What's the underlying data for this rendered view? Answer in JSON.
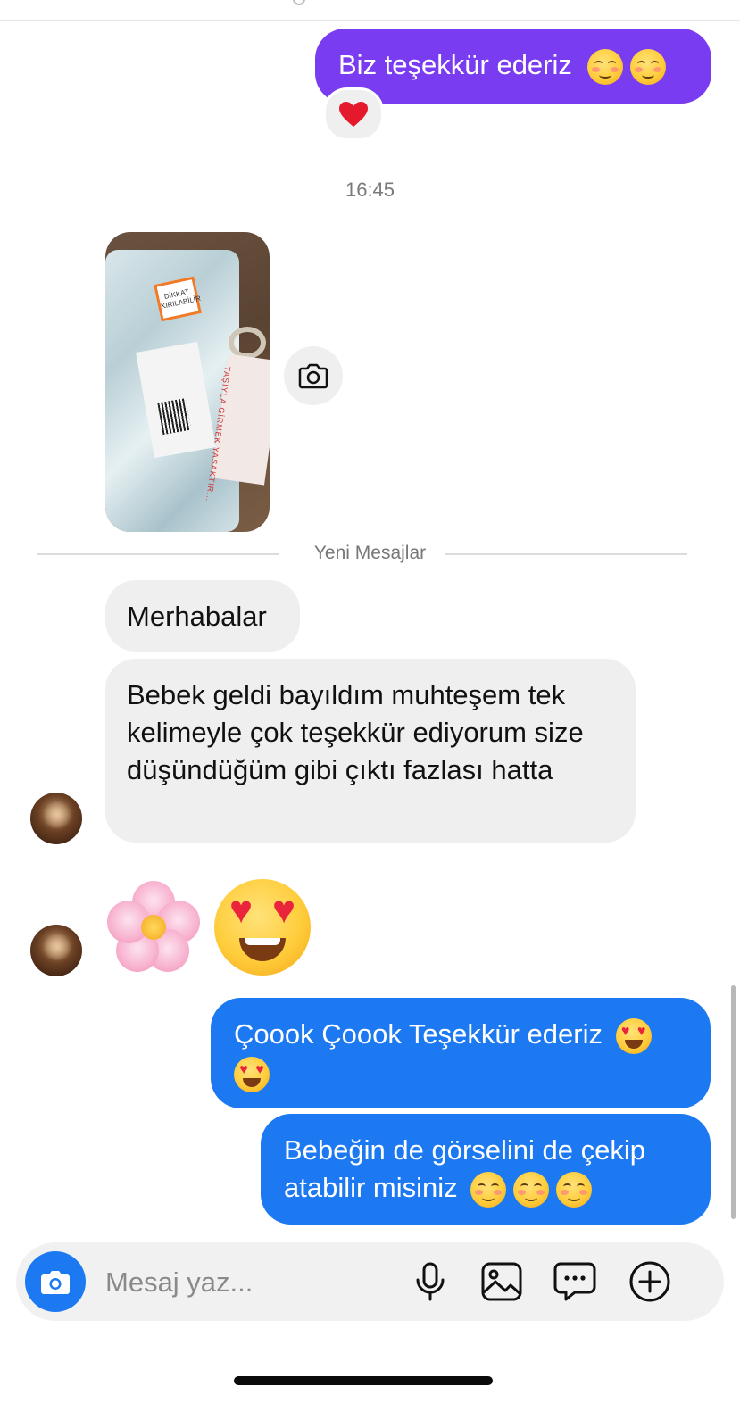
{
  "thread": {
    "timestamp": "16:45",
    "new_messages_label": "Yeni Mesajlar",
    "messages": [
      {
        "from": "me",
        "text": "Biz teşekkür ederiz",
        "emoji": [
          "smiling-blush",
          "smiling-blush"
        ],
        "reaction": "heart"
      },
      {
        "from": "them",
        "type": "photo",
        "photo_text": [
          "DİKKAT KIRILABİLİR",
          "TAŞIYLA GİRMEK YASAKTIR..."
        ]
      },
      {
        "from": "them",
        "text": "Merhabalar"
      },
      {
        "from": "them",
        "text": "Bebek geldi bayıldım muhteşem tek kelimeyle çok teşekkür ediyorum size düşündüğüm gibi çıktı fazlası hatta"
      },
      {
        "from": "them",
        "type": "emoji",
        "emoji": [
          "cherry-blossom",
          "heart-eyes"
        ]
      },
      {
        "from": "me",
        "text": "Çoook Çoook Teşekkür ederiz",
        "emoji": [
          "heart-eyes",
          "heart-eyes"
        ]
      },
      {
        "from": "me",
        "text": "Bebeğin de görselini de çekip atabilir misiniz",
        "emoji": [
          "smiling-blush",
          "smiling-blush",
          "smiling-blush"
        ]
      }
    ]
  },
  "composer": {
    "placeholder": "Mesaj yaz...",
    "icons": [
      "camera-icon",
      "microphone-icon",
      "gallery-icon",
      "sticker-icon",
      "plus-icon"
    ]
  },
  "colors": {
    "outgoing_purple": "#7a3cf0",
    "outgoing_blue": "#1c79f2",
    "incoming": "#efefef",
    "accent": "#1c79f2"
  }
}
